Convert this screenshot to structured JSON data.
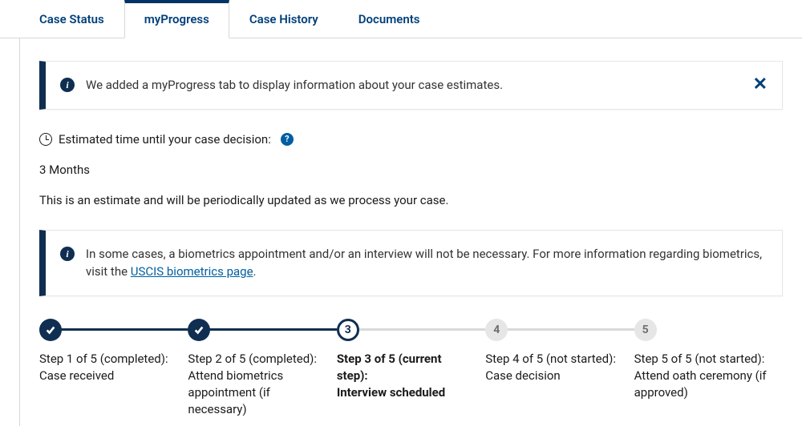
{
  "tabs": [
    {
      "label": "Case Status",
      "active": false
    },
    {
      "label": "myProgress",
      "active": true
    },
    {
      "label": "Case History",
      "active": false
    },
    {
      "label": "Documents",
      "active": false
    }
  ],
  "intro_banner": {
    "text": "We added a myProgress tab to display information about your case estimates."
  },
  "estimate": {
    "label": "Estimated time until your case decision:",
    "help_glyph": "?",
    "value": "3 Months",
    "note": "This is an estimate and will be periodically updated as we process your case."
  },
  "biometrics_banner": {
    "text_prefix": "In some cases, a biometrics appointment and/or an interview will not be necessary. For more information regarding biometrics, visit the ",
    "link_text": "USCIS biometrics page",
    "text_suffix": "."
  },
  "steps": [
    {
      "status": "completed",
      "marker": "✓",
      "title": "Step 1 of 5 (completed):",
      "desc": "Case received"
    },
    {
      "status": "completed",
      "marker": "✓",
      "title": "Step 2 of 5 (completed):",
      "desc": "Attend biometrics appointment (if necessary)"
    },
    {
      "status": "current",
      "marker": "3",
      "title": "Step 3 of 5 (current step):",
      "desc": "Interview scheduled"
    },
    {
      "status": "pending",
      "marker": "4",
      "title": "Step 4 of 5 (not started):",
      "desc": "Case decision"
    },
    {
      "status": "pending",
      "marker": "5",
      "title": "Step 5 of 5 (not started):",
      "desc": "Attend oath ceremony (if approved)"
    }
  ]
}
